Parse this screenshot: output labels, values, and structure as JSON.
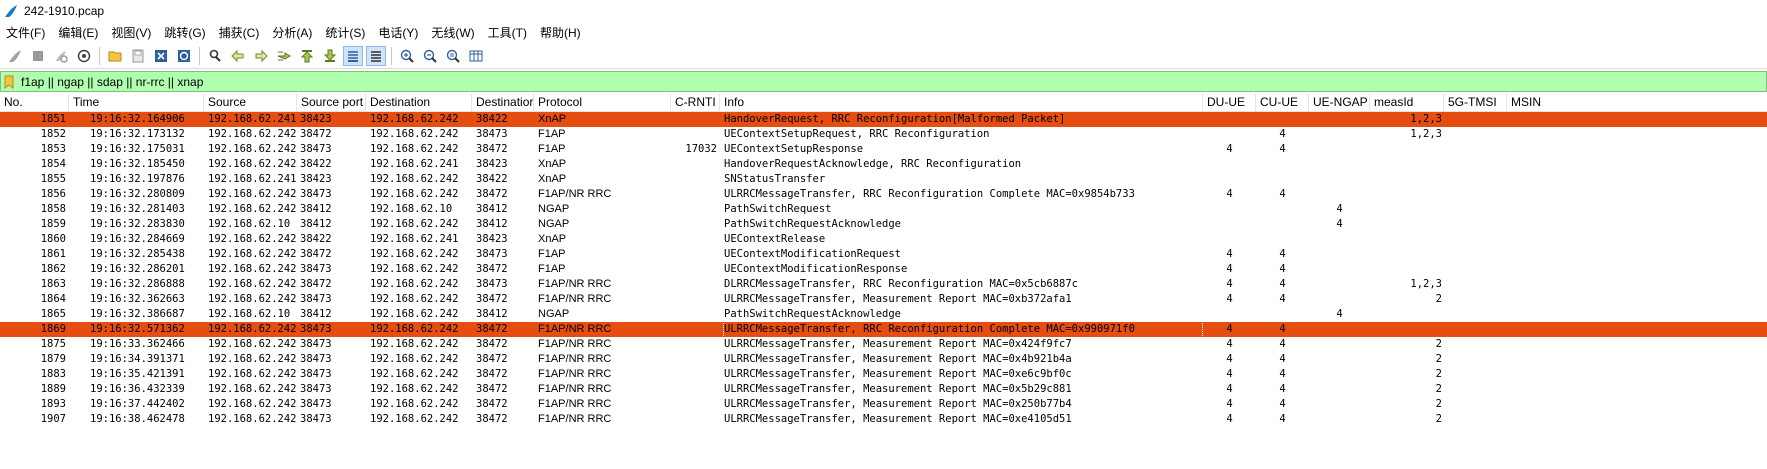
{
  "window": {
    "title": "242-1910.pcap"
  },
  "menu": [
    "文件(F)",
    "编辑(E)",
    "视图(V)",
    "跳转(G)",
    "捕获(C)",
    "分析(A)",
    "统计(S)",
    "电话(Y)",
    "无线(W)",
    "工具(T)",
    "帮助(H)"
  ],
  "filter": {
    "value": "f1ap || ngap || sdap || nr-rrc || xnap"
  },
  "columns": [
    "No.",
    "Time",
    "Source",
    "Source port",
    "Destination",
    "Destinatior",
    "Protocol",
    "C-RNTI",
    "Info",
    "DU-UE",
    "CU-UE",
    "UE-NGAP",
    "measId",
    "5G-TMSI",
    "MSIN"
  ],
  "colors": {
    "marked_row": "#e64d10",
    "filter_bg": "#afffaf"
  },
  "packets": [
    {
      "no": "1851",
      "time": "19:16:32.164906",
      "src": "192.168.62.241",
      "sport": "38423",
      "dst": "192.168.62.242",
      "dport": "38422",
      "proto": "XnAP",
      "crnti": "",
      "info": "HandoverRequest, RRC Reconfiguration[Malformed Packet]",
      "du": "",
      "cu": "",
      "ngap": "",
      "meas": "1,2,3",
      "marked": true
    },
    {
      "no": "1852",
      "time": "19:16:32.173132",
      "src": "192.168.62.242",
      "sport": "38472",
      "dst": "192.168.62.242",
      "dport": "38473",
      "proto": "F1AP",
      "crnti": "",
      "info": "UEContextSetupRequest, RRC Reconfiguration",
      "du": "",
      "cu": "4",
      "ngap": "",
      "meas": "1,2,3"
    },
    {
      "no": "1853",
      "time": "19:16:32.175031",
      "src": "192.168.62.242",
      "sport": "38473",
      "dst": "192.168.62.242",
      "dport": "38472",
      "proto": "F1AP",
      "crnti": "17032",
      "info": "UEContextSetupResponse",
      "du": "4",
      "cu": "4",
      "ngap": "",
      "meas": ""
    },
    {
      "no": "1854",
      "time": "19:16:32.185450",
      "src": "192.168.62.242",
      "sport": "38422",
      "dst": "192.168.62.241",
      "dport": "38423",
      "proto": "XnAP",
      "crnti": "",
      "info": "HandoverRequestAcknowledge, RRC Reconfiguration",
      "du": "",
      "cu": "",
      "ngap": "",
      "meas": ""
    },
    {
      "no": "1855",
      "time": "19:16:32.197876",
      "src": "192.168.62.241",
      "sport": "38423",
      "dst": "192.168.62.242",
      "dport": "38422",
      "proto": "XnAP",
      "crnti": "",
      "info": "SNStatusTransfer",
      "du": "",
      "cu": "",
      "ngap": "",
      "meas": ""
    },
    {
      "no": "1856",
      "time": "19:16:32.280809",
      "src": "192.168.62.242",
      "sport": "38473",
      "dst": "192.168.62.242",
      "dport": "38472",
      "proto": "F1AP/NR RRC",
      "crnti": "",
      "info": "ULRRCMessageTransfer, RRC Reconfiguration Complete MAC=0x9854b733",
      "du": "4",
      "cu": "4",
      "ngap": "",
      "meas": ""
    },
    {
      "no": "1858",
      "time": "19:16:32.281403",
      "src": "192.168.62.242",
      "sport": "38412",
      "dst": "192.168.62.10",
      "dport": "38412",
      "proto": "NGAP",
      "crnti": "",
      "info": "PathSwitchRequest",
      "du": "",
      "cu": "",
      "ngap": "4",
      "meas": ""
    },
    {
      "no": "1859",
      "time": "19:16:32.283830",
      "src": "192.168.62.10",
      "sport": "38412",
      "dst": "192.168.62.242",
      "dport": "38412",
      "proto": "NGAP",
      "crnti": "",
      "info": "PathSwitchRequestAcknowledge",
      "du": "",
      "cu": "",
      "ngap": "4",
      "meas": ""
    },
    {
      "no": "1860",
      "time": "19:16:32.284669",
      "src": "192.168.62.242",
      "sport": "38422",
      "dst": "192.168.62.241",
      "dport": "38423",
      "proto": "XnAP",
      "crnti": "",
      "info": "UEContextRelease",
      "du": "",
      "cu": "",
      "ngap": "",
      "meas": ""
    },
    {
      "no": "1861",
      "time": "19:16:32.285438",
      "src": "192.168.62.242",
      "sport": "38472",
      "dst": "192.168.62.242",
      "dport": "38473",
      "proto": "F1AP",
      "crnti": "",
      "info": "UEContextModificationRequest",
      "du": "4",
      "cu": "4",
      "ngap": "",
      "meas": ""
    },
    {
      "no": "1862",
      "time": "19:16:32.286201",
      "src": "192.168.62.242",
      "sport": "38473",
      "dst": "192.168.62.242",
      "dport": "38472",
      "proto": "F1AP",
      "crnti": "",
      "info": "UEContextModificationResponse",
      "du": "4",
      "cu": "4",
      "ngap": "",
      "meas": ""
    },
    {
      "no": "1863",
      "time": "19:16:32.286888",
      "src": "192.168.62.242",
      "sport": "38472",
      "dst": "192.168.62.242",
      "dport": "38473",
      "proto": "F1AP/NR RRC",
      "crnti": "",
      "info": "DLRRCMessageTransfer, RRC Reconfiguration MAC=0x5cb6887c",
      "du": "4",
      "cu": "4",
      "ngap": "",
      "meas": "1,2,3"
    },
    {
      "no": "1864",
      "time": "19:16:32.362663",
      "src": "192.168.62.242",
      "sport": "38473",
      "dst": "192.168.62.242",
      "dport": "38472",
      "proto": "F1AP/NR RRC",
      "crnti": "",
      "info": "ULRRCMessageTransfer, Measurement Report MAC=0xb372afa1",
      "du": "4",
      "cu": "4",
      "ngap": "",
      "meas": "2"
    },
    {
      "no": "1865",
      "time": "19:16:32.386687",
      "src": "192.168.62.10",
      "sport": "38412",
      "dst": "192.168.62.242",
      "dport": "38412",
      "proto": "NGAP",
      "crnti": "",
      "info": "PathSwitchRequestAcknowledge",
      "du": "",
      "cu": "",
      "ngap": "4",
      "meas": ""
    },
    {
      "no": "1869",
      "time": "19:16:32.571362",
      "src": "192.168.62.242",
      "sport": "38473",
      "dst": "192.168.62.242",
      "dport": "38472",
      "proto": "F1AP/NR RRC",
      "crnti": "",
      "info": "ULRRCMessageTransfer, RRC Reconfiguration Complete MAC=0x990971f0",
      "du": "4",
      "cu": "4",
      "ngap": "",
      "meas": "",
      "marked": true,
      "selected": true
    },
    {
      "no": "1875",
      "time": "19:16:33.362466",
      "src": "192.168.62.242",
      "sport": "38473",
      "dst": "192.168.62.242",
      "dport": "38472",
      "proto": "F1AP/NR RRC",
      "crnti": "",
      "info": "ULRRCMessageTransfer, Measurement Report MAC=0x424f9fc7",
      "du": "4",
      "cu": "4",
      "ngap": "",
      "meas": "2"
    },
    {
      "no": "1879",
      "time": "19:16:34.391371",
      "src": "192.168.62.242",
      "sport": "38473",
      "dst": "192.168.62.242",
      "dport": "38472",
      "proto": "F1AP/NR RRC",
      "crnti": "",
      "info": "ULRRCMessageTransfer, Measurement Report MAC=0x4b921b4a",
      "du": "4",
      "cu": "4",
      "ngap": "",
      "meas": "2"
    },
    {
      "no": "1883",
      "time": "19:16:35.421391",
      "src": "192.168.62.242",
      "sport": "38473",
      "dst": "192.168.62.242",
      "dport": "38472",
      "proto": "F1AP/NR RRC",
      "crnti": "",
      "info": "ULRRCMessageTransfer, Measurement Report MAC=0xe6c9bf0c",
      "du": "4",
      "cu": "4",
      "ngap": "",
      "meas": "2"
    },
    {
      "no": "1889",
      "time": "19:16:36.432339",
      "src": "192.168.62.242",
      "sport": "38473",
      "dst": "192.168.62.242",
      "dport": "38472",
      "proto": "F1AP/NR RRC",
      "crnti": "",
      "info": "ULRRCMessageTransfer, Measurement Report MAC=0x5b29c881",
      "du": "4",
      "cu": "4",
      "ngap": "",
      "meas": "2"
    },
    {
      "no": "1893",
      "time": "19:16:37.442402",
      "src": "192.168.62.242",
      "sport": "38473",
      "dst": "192.168.62.242",
      "dport": "38472",
      "proto": "F1AP/NR RRC",
      "crnti": "",
      "info": "ULRRCMessageTransfer, Measurement Report MAC=0x250b77b4",
      "du": "4",
      "cu": "4",
      "ngap": "",
      "meas": "2"
    },
    {
      "no": "1907",
      "time": "19:16:38.462478",
      "src": "192.168.62.242",
      "sport": "38473",
      "dst": "192.168.62.242",
      "dport": "38472",
      "proto": "F1AP/NR RRC",
      "crnti": "",
      "info": "ULRRCMessageTransfer, Measurement Report MAC=0xe4105d51",
      "du": "4",
      "cu": "4",
      "ngap": "",
      "meas": "2"
    }
  ]
}
